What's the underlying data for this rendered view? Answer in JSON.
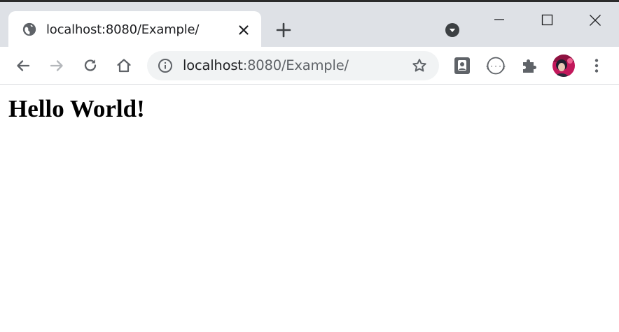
{
  "browser": {
    "tab": {
      "title": "localhost:8080/Example/",
      "favicon": "globe-icon",
      "close_icon": "close-icon"
    },
    "new_tab_icon": "plus-icon",
    "tab_search_icon": "tab-search-icon",
    "window_controls": {
      "minimize": "minimize-icon",
      "maximize": "maximize-icon",
      "close": "close-icon"
    },
    "toolbar": {
      "back_icon": "back-arrow-icon",
      "forward_icon": "forward-arrow-icon",
      "reload_icon": "reload-icon",
      "home_icon": "home-icon",
      "address": {
        "host": "localhost",
        "rest": ":8080/Example/",
        "info_icon": "info-icon",
        "bookmark_icon": "star-icon"
      },
      "extensions": [
        "contact-card-icon",
        "json-viewer-icon",
        "puzzle-icon"
      ],
      "profile": "avatar",
      "menu_icon": "kebab-menu-icon"
    },
    "colors": {
      "tabbar_bg": "#dee1e6",
      "omnibox_bg": "#f1f3f4",
      "icon": "#5f6368",
      "text": "#202124"
    }
  },
  "page": {
    "heading": "Hello World!"
  }
}
